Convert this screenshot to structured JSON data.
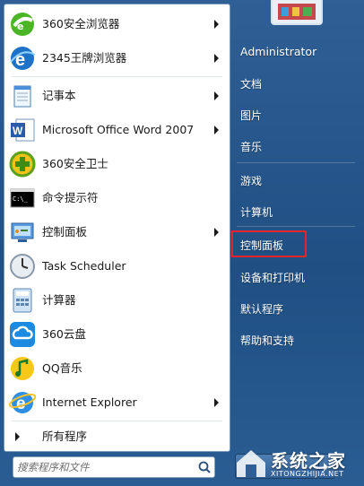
{
  "programs": [
    {
      "label": "360安全浏览器",
      "has_submenu": true,
      "icon": "360-browser-icon"
    },
    {
      "label": "2345王牌浏览器",
      "has_submenu": true,
      "icon": "2345-browser-icon"
    },
    {
      "label": "记事本",
      "has_submenu": true,
      "icon": "notepad-icon"
    },
    {
      "label": "Microsoft Office Word 2007",
      "has_submenu": true,
      "icon": "word-icon"
    },
    {
      "label": "360安全卫士",
      "has_submenu": false,
      "icon": "360-safe-icon"
    },
    {
      "label": "命令提示符",
      "has_submenu": false,
      "icon": "cmd-icon",
      "icon_text": "C:\\_"
    },
    {
      "label": "控制面板",
      "has_submenu": true,
      "icon": "control-panel-icon"
    },
    {
      "label": "Task Scheduler",
      "has_submenu": false,
      "icon": "task-scheduler-icon"
    },
    {
      "label": "计算器",
      "has_submenu": false,
      "icon": "calculator-icon"
    },
    {
      "label": "360云盘",
      "has_submenu": false,
      "icon": "360-cloud-icon"
    },
    {
      "label": "QQ音乐",
      "has_submenu": false,
      "icon": "qq-music-icon"
    },
    {
      "label": "Internet Explorer",
      "has_submenu": true,
      "icon": "ie-icon"
    }
  ],
  "all_programs": "所有程序",
  "search": {
    "placeholder": "搜索程序和文件"
  },
  "right": {
    "user": "Administrator",
    "items": [
      "文档",
      "图片",
      "音乐",
      "游戏",
      "计算机",
      "控制面板",
      "设备和打印机",
      "默认程序",
      "帮助和支持"
    ],
    "highlighted": "控制面板"
  },
  "watermark": {
    "brand": "系统之家",
    "url": "XITONGZHIJIA.NET"
  },
  "colors": {
    "highlight": "#e3262b",
    "panel": "#2f5f95"
  }
}
